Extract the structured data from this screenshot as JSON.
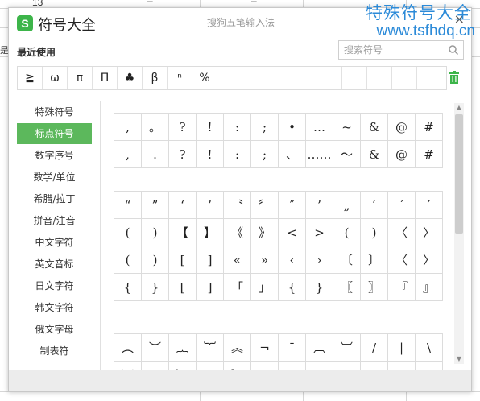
{
  "spreadsheet": {
    "row_number": "13",
    "dash": "–",
    "fragment": "是"
  },
  "watermark": {
    "title": "特殊符号大全",
    "url": "www.tsfhdq.cn"
  },
  "dialog": {
    "app_title": "符号大全",
    "subtitle": "搜狗五笔输入法",
    "close_icon": "×",
    "recent_label": "最近使用",
    "search_placeholder": "搜索符号",
    "recent_symbols": [
      "≧",
      "ω",
      "π",
      "Π",
      "♣",
      "β",
      "ⁿ",
      "%",
      "",
      "",
      "",
      "",
      "",
      "",
      "",
      "",
      ""
    ],
    "categories": [
      "特殊符号",
      "标点符号",
      "数字序号",
      "数学/单位",
      "希腊/拉丁",
      "拼音/注音",
      "中文字符",
      "英文音标",
      "日文字符",
      "韩文字符",
      "俄文字母",
      "制表符"
    ],
    "active_category": "标点符号",
    "grid_sections": [
      {
        "rows": [
          [
            ",",
            "。",
            "?",
            "!",
            ":",
            ";",
            "•",
            "…",
            "~",
            "&",
            "@",
            "#"
          ],
          [
            ",",
            ".",
            "?",
            "!",
            ":",
            ";",
            "、",
            "……",
            "～",
            "&",
            "@",
            "#"
          ]
        ]
      },
      {
        "rows": [
          [
            "“",
            "”",
            "‘",
            "’",
            "〝",
            "〞",
            "″",
            "’",
            "„",
            "′",
            "´",
            "′"
          ],
          [
            "(",
            ")",
            "【",
            "】",
            "《",
            "》",
            "<",
            ">",
            "(",
            ")",
            "〈",
            "〉"
          ],
          [
            "(",
            ")",
            "[",
            "]",
            "«",
            "»",
            "‹",
            "›",
            "〔",
            "〕",
            "〈",
            "〉"
          ],
          [
            "{",
            "}",
            "[",
            "]",
            "「",
            "」",
            "{",
            "}",
            "〖",
            "〗",
            "『",
            "』"
          ]
        ]
      },
      {
        "rows": [
          [
            "︵",
            "︶",
            "︷",
            "︸",
            "︽",
            "¬",
            "¯",
            "︹",
            "︺",
            "/",
            "|",
            "\\"
          ],
          [
            "﹀",
            "﹁",
            "﹂",
            "﹃",
            "﹄",
            "",
            "",
            "",
            "",
            "",
            "",
            ""
          ]
        ]
      }
    ]
  },
  "colors": {
    "accent_green": "#5cb85c",
    "watermark_blue": "#2b8ad8"
  },
  "icons": {
    "search": "search-icon",
    "trash": "trash-icon",
    "close": "close-icon",
    "logo": "sogou-logo-icon"
  }
}
